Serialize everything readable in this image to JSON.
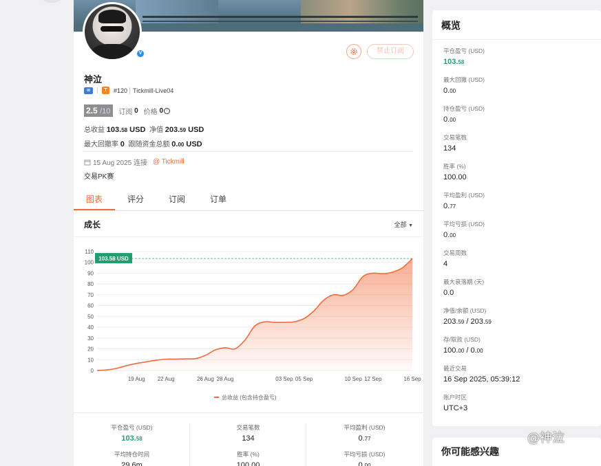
{
  "profile": {
    "name": "神泣",
    "rank": "#120",
    "account": "Tickmill-Live04",
    "score": "2.5",
    "score_max": "/10",
    "subs_label": "订阅",
    "subs_value": "0",
    "price_label": "价格",
    "price_value": "0",
    "total_profit_label": "总收益",
    "total_profit_int": "103.",
    "total_profit_dec": "58",
    "total_profit_unit": "USD",
    "equity_label": "净值",
    "equity_int": "203.",
    "equity_dec": "59",
    "equity_unit": "USD",
    "max_dd_label": "最大回撤率",
    "max_dd_value": "0",
    "follow_label": "跟随资金总额",
    "follow_int": "0.",
    "follow_dec": "00",
    "follow_unit": "USD",
    "connect_date": "15 Aug 2025 连接",
    "broker": "@ Tickmill",
    "description": "交易PK赛"
  },
  "buttons": {
    "stop_sub": "禁止订阅"
  },
  "tabs": [
    "图表",
    "评分",
    "订阅",
    "订单"
  ],
  "growth": {
    "title": "成长",
    "range": "全部"
  },
  "chart_data": {
    "type": "area",
    "x": [
      "15 Aug",
      "16 Aug",
      "17 Aug",
      "18 Aug",
      "19 Aug",
      "20 Aug",
      "21 Aug",
      "22 Aug",
      "23 Aug",
      "24 Aug",
      "25 Aug",
      "26 Aug",
      "27 Aug",
      "28 Aug",
      "29 Aug",
      "30 Aug",
      "31 Aug",
      "01 Sep",
      "02 Sep",
      "03 Sep",
      "04 Sep",
      "05 Sep",
      "06 Sep",
      "07 Sep",
      "08 Sep",
      "09 Sep",
      "10 Sep",
      "11 Sep",
      "12 Sep",
      "13 Sep",
      "14 Sep",
      "15 Sep",
      "16 Sep"
    ],
    "series": [
      {
        "name": "总收益 (包含持仓盈亏)",
        "values": [
          0,
          0.5,
          2,
          4.5,
          6.5,
          8,
          9.5,
          10.5,
          10.5,
          10.8,
          11,
          14,
          19,
          21,
          20,
          28,
          41,
          45,
          44.5,
          44.5,
          45,
          48,
          55,
          65,
          70,
          69.5,
          75,
          87,
          90,
          89.5,
          91,
          95,
          103.58
        ]
      }
    ],
    "x_ticks": [
      "19 Aug",
      "22 Aug",
      "26 Aug",
      "28 Aug",
      "03 Sep",
      "05 Sep",
      "10 Sep",
      "12 Sep",
      "16 Sep"
    ],
    "y_ticks": [
      0,
      10,
      20,
      30,
      40,
      50,
      60,
      70,
      80,
      90,
      100,
      110
    ],
    "ylim": [
      0,
      110
    ],
    "reference_line": 103.58,
    "reference_label": "103.58 USD",
    "legend_label": "总收益 (包含持仓盈亏)",
    "grid": true,
    "color": "#f26b3a"
  },
  "summary": [
    {
      "label": "平仓盈亏 (USD)",
      "int": "103.",
      "dec": "58",
      "green": true
    },
    {
      "label": "交易笔数",
      "int": "134",
      "dec": "",
      "green": false
    },
    {
      "label": "平均盈利 (USD)",
      "int": "0.",
      "dec": "77",
      "green": false
    },
    {
      "label": "平均持仓时间",
      "int": "29.6m",
      "dec": "",
      "green": false
    },
    {
      "label": "胜率 (%)",
      "int": "100.00",
      "dec": "",
      "green": false
    },
    {
      "label": "平均亏损 (USD)",
      "int": "0.",
      "dec": "00",
      "green": false
    }
  ],
  "overview": {
    "title": "概览",
    "items": [
      {
        "label": "平仓盈亏 (USD)",
        "int": "103.",
        "dec": "58",
        "green": true
      },
      {
        "label": "最大回撤 (USD)",
        "int": "0.",
        "dec": "00"
      },
      {
        "label": "持仓盈亏 (USD)",
        "int": "0.",
        "dec": "00"
      },
      {
        "label": "交易笔数",
        "int": "134",
        "dec": ""
      },
      {
        "label": "胜率 (%)",
        "int": "100.00",
        "dec": ""
      },
      {
        "label": "平均盈利 (USD)",
        "int": "0.",
        "dec": "77"
      },
      {
        "label": "平均亏损 (USD)",
        "int": "0.",
        "dec": "00"
      },
      {
        "label": "交易周数",
        "int": "4",
        "dec": ""
      },
      {
        "label": "最大衰落期 (天)",
        "int": "0.0",
        "dec": ""
      },
      {
        "label": "净值/余额 (USD)",
        "int": "203.",
        "dec": "59",
        "int2": " / 203.",
        "dec2": "59"
      },
      {
        "label": "存/取款 (USD)",
        "int": "100.",
        "dec": "00",
        "int2": " / 0.",
        "dec2": "00"
      },
      {
        "label": "最近交易",
        "int": "16 Sep 2025, 05:39:12",
        "dec": ""
      },
      {
        "label": "账户时区",
        "int": "UTC+3",
        "dec": ""
      }
    ]
  },
  "interest_title": "你可能感兴趣",
  "watermark": "@神泣"
}
